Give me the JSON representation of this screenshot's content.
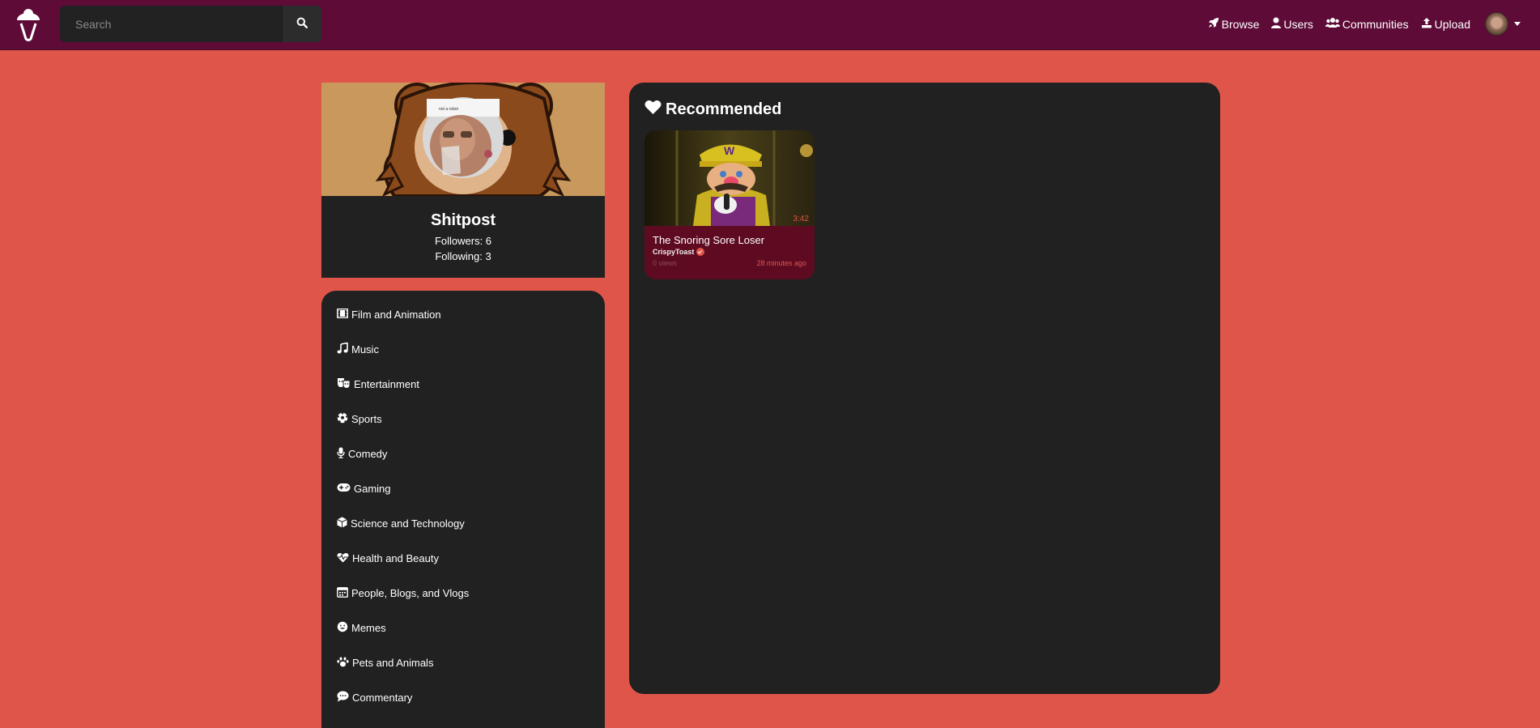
{
  "nav": {
    "search_placeholder": "Search",
    "links": {
      "browse": "Browse",
      "users": "Users",
      "communities": "Communities",
      "upload": "Upload"
    }
  },
  "profile": {
    "name": "Shitpost",
    "followers": "Followers: 6",
    "following": "Following: 3"
  },
  "categories": {
    "film": "Film and Animation",
    "music": "Music",
    "entertainment": "Entertainment",
    "sports": "Sports",
    "comedy": "Comedy",
    "gaming": "Gaming",
    "science": "Science and Technology",
    "health": "Health and Beauty",
    "people": "People, Blogs, and Vlogs",
    "memes": "Memes",
    "pets": "Pets and Animals",
    "commentary": "Commentary"
  },
  "recommended": {
    "title": "Recommended",
    "video": {
      "title": "The Snoring Sore Loser",
      "author": "CrispyToast",
      "views": "0 views",
      "time": "28 minutes ago",
      "duration": "3:42"
    }
  },
  "colors": {
    "background": "#e0554a",
    "navbar": "#5e0b38",
    "panel": "#212121",
    "card": "#5e0b22",
    "accent": "#e0554a"
  }
}
